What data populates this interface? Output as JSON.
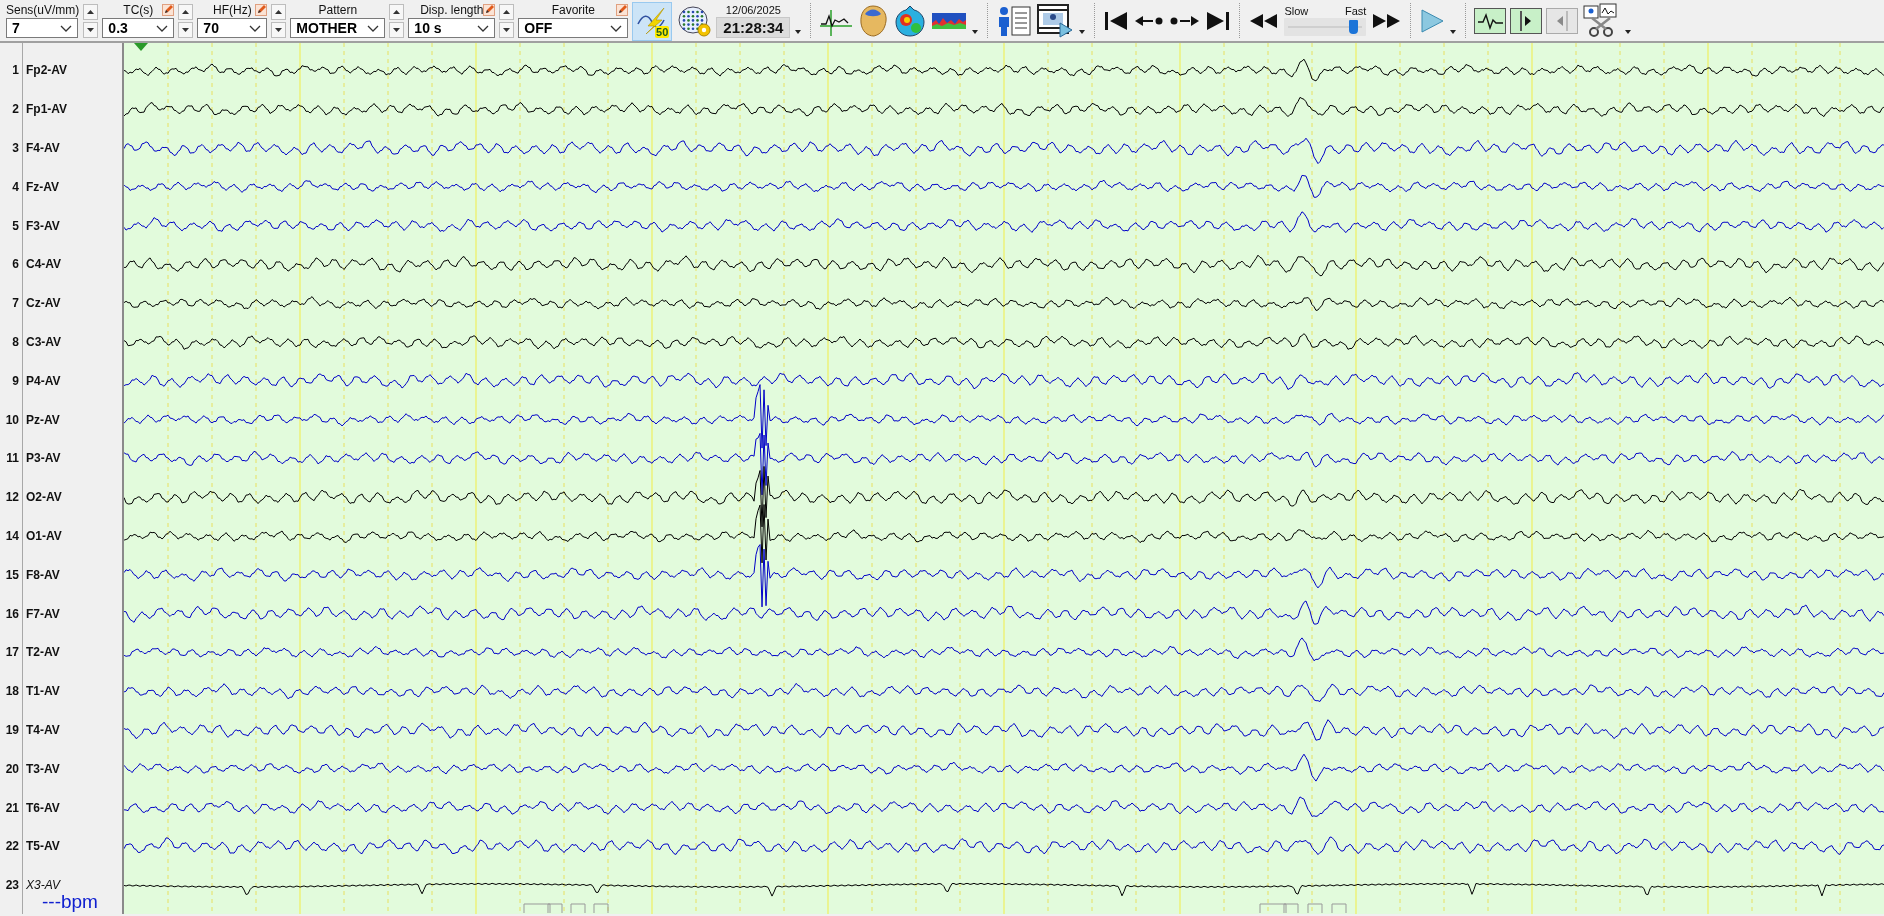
{
  "toolbar": {
    "fields": [
      {
        "label": "Sens(uV/mm)",
        "value": "7",
        "editable": false,
        "spinner": true
      },
      {
        "label": "TC(s)",
        "value": "0.3",
        "editable": true,
        "spinner": true
      },
      {
        "label": "HF(Hz)",
        "value": "70",
        "editable": true,
        "spinner": true
      },
      {
        "label": "Pattern",
        "value": "MOTHER",
        "editable": false,
        "spinner": true
      },
      {
        "label": "Disp. length",
        "value": "10 s",
        "editable": true,
        "spinner": true
      },
      {
        "label": "Favorite",
        "value": "OFF",
        "editable": true,
        "spinner": false
      }
    ],
    "filter": {
      "badge": "50",
      "selected": true
    },
    "date": "12/06/2025",
    "time": "21:28:34",
    "speed": {
      "slow_label": "Slow",
      "fast_label": "Fast",
      "level": 0.85
    },
    "back_frame": {
      "disabled": true
    }
  },
  "channels": [
    {
      "number": "1",
      "name": "Fp2-AV",
      "color": "#000000",
      "kind": "eeg"
    },
    {
      "number": "2",
      "name": "Fp1-AV",
      "color": "#000000",
      "kind": "eeg"
    },
    {
      "number": "3",
      "name": "F4-AV",
      "color": "#0000c8",
      "kind": "eeg"
    },
    {
      "number": "4",
      "name": "Fz-AV",
      "color": "#0000c8",
      "kind": "eeg"
    },
    {
      "number": "5",
      "name": "F3-AV",
      "color": "#0000c8",
      "kind": "eeg"
    },
    {
      "number": "6",
      "name": "C4-AV",
      "color": "#000000",
      "kind": "eeg"
    },
    {
      "number": "7",
      "name": "Cz-AV",
      "color": "#000000",
      "kind": "eeg"
    },
    {
      "number": "8",
      "name": "C3-AV",
      "color": "#000000",
      "kind": "eeg"
    },
    {
      "number": "9",
      "name": "P4-AV",
      "color": "#0000c8",
      "kind": "eeg"
    },
    {
      "number": "10",
      "name": "Pz-AV",
      "color": "#0000c8",
      "kind": "eeg"
    },
    {
      "number": "11",
      "name": "P3-AV",
      "color": "#0000c8",
      "kind": "eeg"
    },
    {
      "number": "12",
      "name": "O2-AV",
      "color": "#000000",
      "kind": "eeg"
    },
    {
      "number": "14",
      "name": "O1-AV",
      "color": "#000000",
      "kind": "eeg"
    },
    {
      "number": "15",
      "name": "F8-AV",
      "color": "#0000c8",
      "kind": "eeg"
    },
    {
      "number": "16",
      "name": "F7-AV",
      "color": "#0000c8",
      "kind": "eeg"
    },
    {
      "number": "17",
      "name": "T2-AV",
      "color": "#0000c8",
      "kind": "eeg"
    },
    {
      "number": "18",
      "name": "T1-AV",
      "color": "#0000c8",
      "kind": "eeg"
    },
    {
      "number": "19",
      "name": "T4-AV",
      "color": "#0000c8",
      "kind": "eeg"
    },
    {
      "number": "20",
      "name": "T3-AV",
      "color": "#0000c8",
      "kind": "eeg"
    },
    {
      "number": "21",
      "name": "T6-AV",
      "color": "#0000c8",
      "kind": "eeg"
    },
    {
      "number": "22",
      "name": "T5-AV",
      "color": "#0000c8",
      "kind": "eeg"
    },
    {
      "number": "23",
      "name": "X3-AV",
      "color": "#000000",
      "kind": "auxiliary"
    }
  ],
  "heart_rate": "---bpm"
}
